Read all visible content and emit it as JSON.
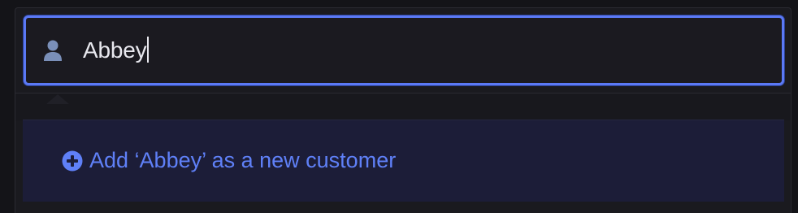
{
  "search": {
    "value": "Abbey",
    "icon": "person-icon"
  },
  "dropdown": {
    "add_option_label": "Add ‘Abbey’ as a new customer",
    "add_icon": "plus-circle-icon"
  },
  "colors": {
    "accent": "#5b79f5",
    "link": "#5f80f7",
    "panel_bg": "#1a1a1f",
    "dropdown_bg": "#1c1d38",
    "text": "#e8e8ee",
    "icon": "#7a8fb8"
  }
}
